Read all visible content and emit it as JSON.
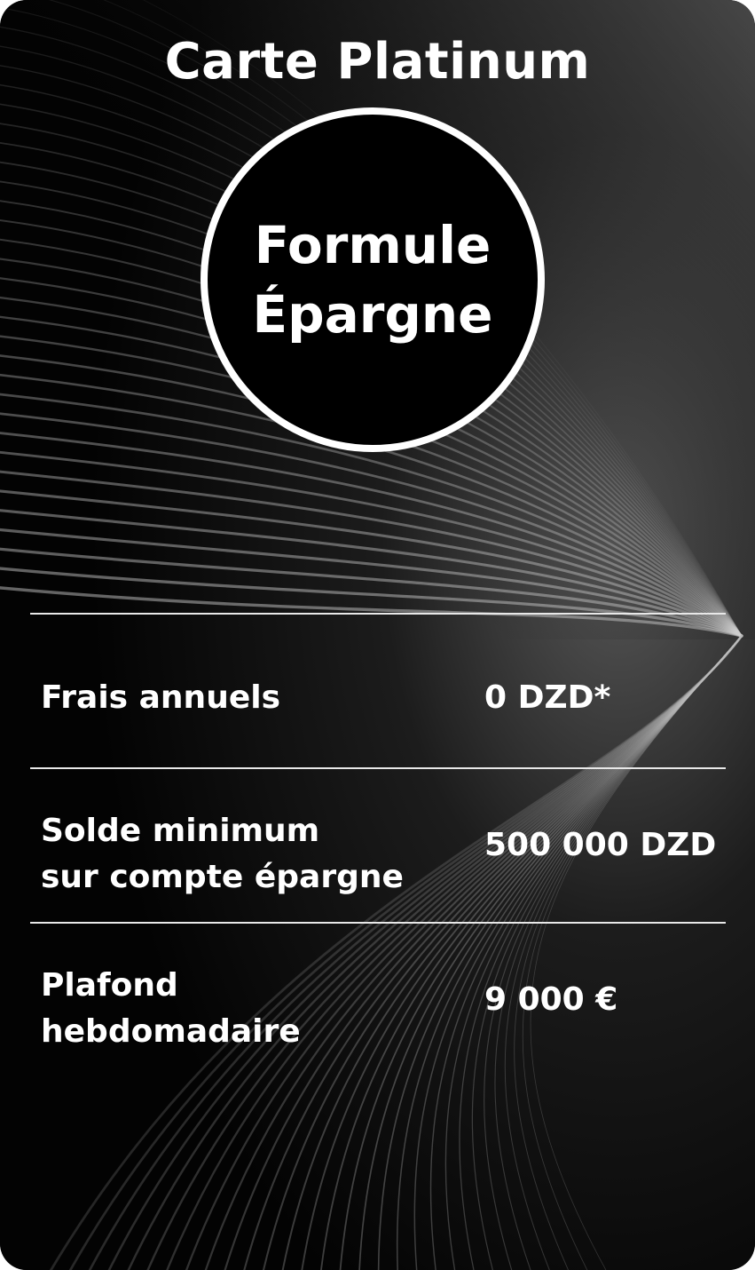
{
  "card": {
    "title": "Carte Platinum",
    "badge": {
      "line1": "Formule",
      "line2": "Épargne"
    },
    "rows": [
      {
        "label_lines": [
          "Frais annuels"
        ],
        "value": "0 DZD*"
      },
      {
        "label_lines": [
          "Solde minimum",
          "sur compte épargne"
        ],
        "value": "500 000 DZD"
      },
      {
        "label_lines": [
          "Plafond",
          "hebdomadaire"
        ],
        "value": "9 000 €"
      }
    ],
    "colors": {
      "background": "#050505",
      "text": "#ffffff",
      "divider": "#e8e8e8"
    }
  }
}
